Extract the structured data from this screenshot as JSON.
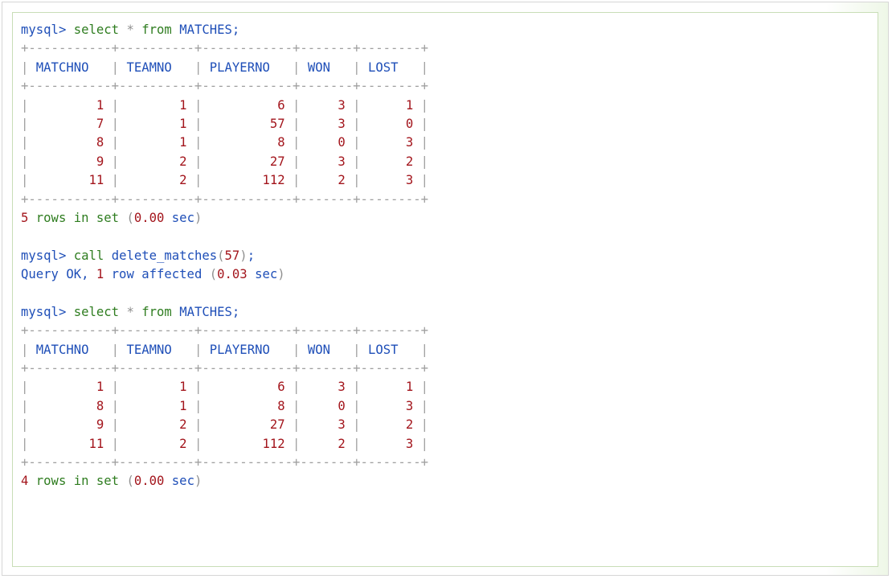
{
  "terminal": {
    "prompt": "mysql>",
    "first_query": {
      "keyword_select": "select",
      "star": "*",
      "keyword_from": "from",
      "table": "MATCHES;"
    },
    "first_result": {
      "columns": [
        "MATCHNO",
        "TEAMNO",
        "PLAYERNO",
        "WON",
        "LOST"
      ],
      "rows": [
        [
          "1",
          "1",
          "6",
          "3",
          "1"
        ],
        [
          "7",
          "1",
          "57",
          "3",
          "0"
        ],
        [
          "8",
          "1",
          "8",
          "0",
          "3"
        ],
        [
          "9",
          "2",
          "27",
          "3",
          "2"
        ],
        [
          "11",
          "2",
          "112",
          "2",
          "3"
        ]
      ],
      "summary_count": "5",
      "summary_text": "rows in set",
      "summary_time": "0.00",
      "summary_unit": "sec"
    },
    "call_statement": {
      "keyword_call": "call",
      "procedure": "delete_matches",
      "argument": "57",
      "terminator": ";"
    },
    "call_result": {
      "status": "Query OK,",
      "count": "1",
      "text": "row affected",
      "time": "0.03",
      "unit": "sec"
    },
    "second_query": {
      "keyword_select": "select",
      "star": "*",
      "keyword_from": "from",
      "table": "MATCHES;"
    },
    "second_result": {
      "columns": [
        "MATCHNO",
        "TEAMNO",
        "PLAYERNO",
        "WON",
        "LOST"
      ],
      "rows": [
        [
          "1",
          "1",
          "6",
          "3",
          "1"
        ],
        [
          "8",
          "1",
          "8",
          "0",
          "3"
        ],
        [
          "9",
          "2",
          "27",
          "3",
          "2"
        ],
        [
          "11",
          "2",
          "112",
          "2",
          "3"
        ]
      ],
      "summary_count": "4",
      "summary_text": "rows in set",
      "summary_time": "0.00",
      "summary_unit": "sec"
    }
  }
}
